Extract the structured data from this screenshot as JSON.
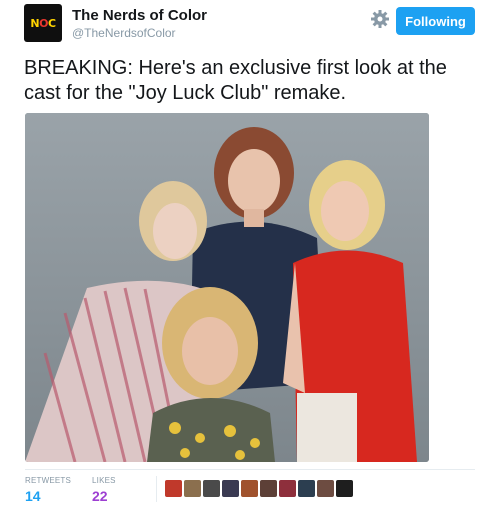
{
  "account": {
    "name": "The Nerds of Color",
    "handle": "@TheNerdsofColor",
    "avatar_letters": [
      "N",
      "O",
      "C"
    ]
  },
  "follow_button": {
    "label": "Following"
  },
  "settings_icon": "gear-icon",
  "tweet": {
    "text": "BREAKING: Here's an exclusive first look at the cast for the \"Joy Luck Club\" remake."
  },
  "stats": {
    "retweets_label": "RETWEETS",
    "retweets_count": "14",
    "likes_label": "LIKES",
    "likes_count": "22"
  },
  "likers": {
    "colors": [
      "#c0392b",
      "#8b6f4e",
      "#4a4a4a",
      "#3a3a52",
      "#a0522d",
      "#5d4037",
      "#8e2f3c",
      "#2c3e50",
      "#6d4c41",
      "#1e1e1e"
    ]
  },
  "colors": {
    "brand_blue": "#1da1f2",
    "likes_purple": "#9d3fd2",
    "avatar_bg": "#0f0f0f",
    "avatar_yellow": "#ffd400",
    "avatar_red": "#e8362e"
  }
}
